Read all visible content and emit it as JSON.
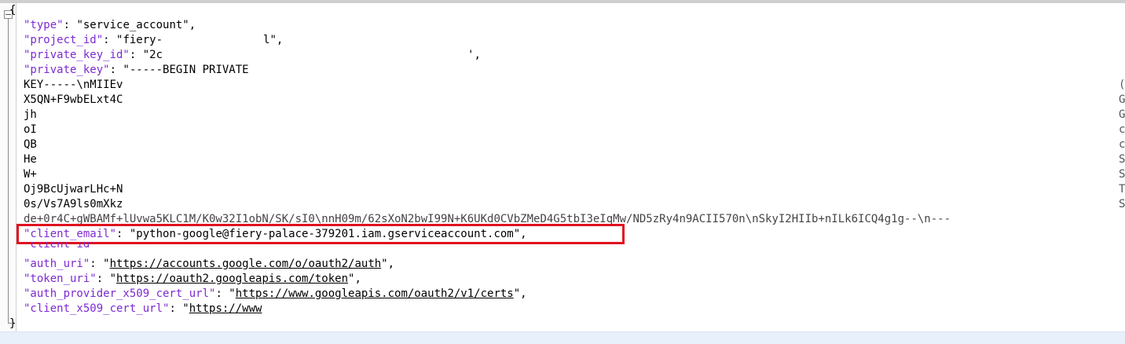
{
  "editor": {
    "open_brace": "{",
    "close_brace": "}"
  },
  "json_lines": {
    "type": {
      "key": "\"type\"",
      "value": "\"service_account\""
    },
    "project_id": {
      "key": "\"project_id\"",
      "value_visible": "\"fiery-",
      "value_tail": "l\""
    },
    "private_key_id": {
      "key": "\"private_key_id\"",
      "value_visible": "\"2c",
      "value_tail": "'"
    },
    "private_key": {
      "key": "\"private_key\"",
      "value": "\"-----BEGIN PRIVATE"
    },
    "key_continuation": [
      "KEY-----\\nMIIEv",
      "X5QN+F9wbELxt4C",
      "jh",
      "oI",
      "QB",
      "He",
      "W+",
      "Oj9BcUjwarLHc+N",
      "0s/Vs7A9ls0mXkz",
      "de+0r4C+gWBAMf+lUvwa5KLC1M/K0w32I1obN/SK/sI0\\nnH09m/62sXoN2bwI99N+K6UKd0CVbZMeD4G5tbI3eIqMw/ND5zRy4n9ACII570n\\nSkyI2HIIb+nILk6ICQ4g1g--\\n---"
    ],
    "client_email": {
      "key": "\"client_email\"",
      "value": "\"python-google@fiery-palace-379201.iam.gserviceaccount.com\""
    },
    "client_id": {
      "key": "\"client_id\"",
      "value_visible": "\"",
      "value_tail": "\""
    },
    "auth_uri": {
      "key": "\"auth_uri\"",
      "value": "https://accounts.google.com/o/oauth2/auth"
    },
    "token_uri": {
      "key": "\"token_uri\"",
      "value": "https://oauth2.googleapis.com/token"
    },
    "auth_provider_x509_cert_url": {
      "key": "\"auth_provider_x509_cert_url\"",
      "value": "https://www.googleapis.com/oauth2/v1/certs"
    },
    "client_x509_cert_url": {
      "key": "\"client_x509_cert_url\"",
      "value": "https://www"
    }
  },
  "right_edge_chars": [
    "(",
    "G",
    "G",
    "c",
    "c",
    "S",
    "S",
    "T",
    "S"
  ],
  "colors": {
    "key": "#7d2bd1",
    "highlight_border": "#e0121f",
    "gutter_border": "#cfcfcf",
    "current_line": "#e8f0fc"
  },
  "icons": {
    "fold_toggle": "minus-box-icon"
  }
}
